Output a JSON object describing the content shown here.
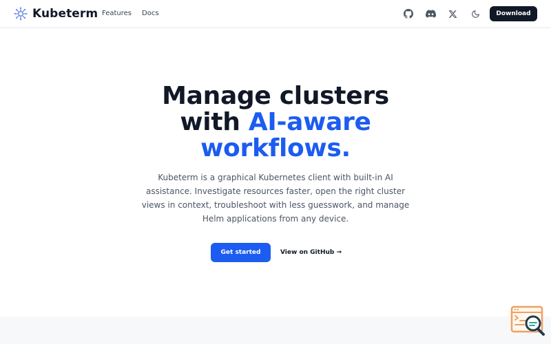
{
  "brand": {
    "name": "Kubeterm",
    "logo_icon": "kubernetes-helm-icon",
    "logo_color": "#6b8ce6"
  },
  "nav": {
    "items": [
      {
        "label": "Features"
      },
      {
        "label": "Docs"
      }
    ]
  },
  "header_actions": {
    "icons": [
      "github-icon",
      "discord-icon",
      "x-icon",
      "moon-icon"
    ],
    "download_label": "Download"
  },
  "hero": {
    "title_line1": "Manage clusters",
    "title_line2_prefix": "with ",
    "title_accent_line2": "AI-aware",
    "title_accent_line3": "workflows.",
    "description": "Kubeterm is a graphical Kubernetes client with built-in AI assistance. Investigate resources faster, open the right cluster views in context, troubleshoot with less guesswork, and manage Helm applications from any device.",
    "primary_cta": "Get started",
    "secondary_cta": "View on GitHub →"
  },
  "colors": {
    "accent": "#1d5cf0",
    "dark": "#111827",
    "muted_text": "#4b5563",
    "widget_orange": "#f0a060",
    "widget_dark": "#1f3b4d"
  },
  "widget": {
    "icon": "terminal-search-icon"
  }
}
